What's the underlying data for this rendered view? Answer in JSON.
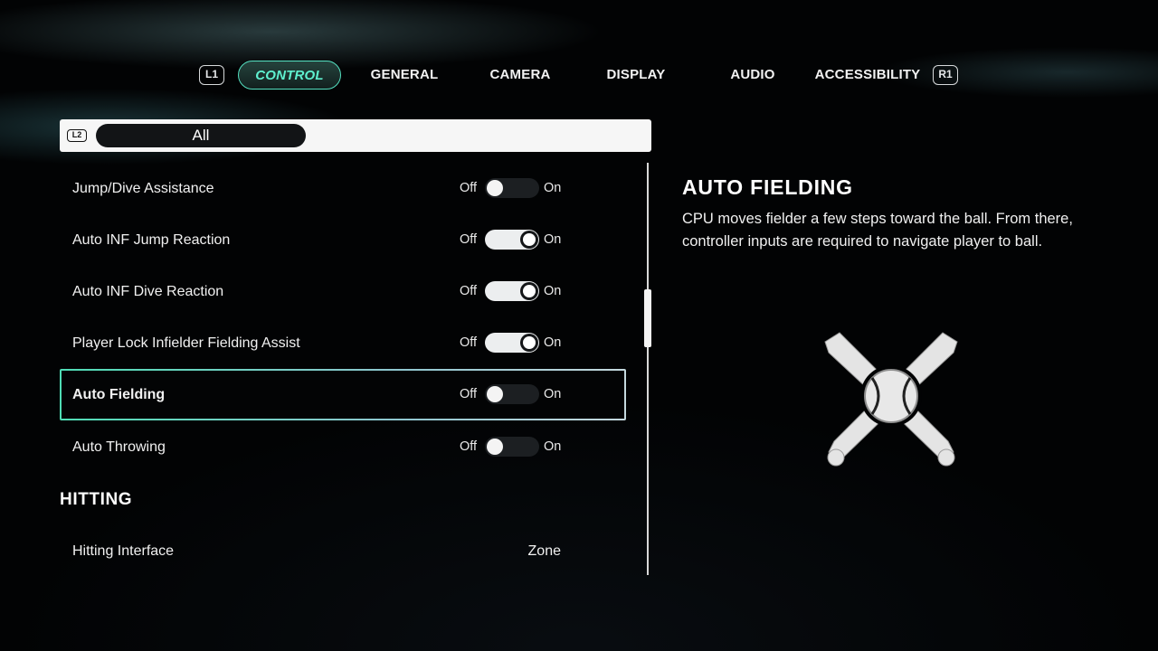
{
  "tabs": {
    "left_shoulder": "L1",
    "right_shoulder": "R1",
    "items": [
      {
        "label": "CONTROL",
        "active": true
      },
      {
        "label": "GENERAL",
        "active": false
      },
      {
        "label": "CAMERA",
        "active": false
      },
      {
        "label": "DISPLAY",
        "active": false
      },
      {
        "label": "AUDIO",
        "active": false
      },
      {
        "label": "ACCESSIBILITY",
        "active": false
      }
    ]
  },
  "filter": {
    "button": "L2",
    "value": "All"
  },
  "settings": [
    {
      "label": "Jump/Dive Assistance",
      "off_label": "Off",
      "on_label": "On",
      "state": "off"
    },
    {
      "label": "Auto INF Jump Reaction",
      "off_label": "Off",
      "on_label": "On",
      "state": "on"
    },
    {
      "label": "Auto INF Dive Reaction",
      "off_label": "Off",
      "on_label": "On",
      "state": "on"
    },
    {
      "label": "Player Lock Infielder Fielding Assist",
      "off_label": "Off",
      "on_label": "On",
      "state": "on"
    },
    {
      "label": "Auto Fielding",
      "off_label": "Off",
      "on_label": "On",
      "state": "off",
      "selected": true
    },
    {
      "label": "Auto Throwing",
      "off_label": "Off",
      "on_label": "On",
      "state": "off"
    }
  ],
  "hitting": {
    "header": "HITTING",
    "items": [
      {
        "label": "Hitting Interface",
        "value": "Zone"
      }
    ]
  },
  "info": {
    "title": "AUTO FIELDING",
    "description": "CPU moves fielder a few steps toward the ball. From there, controller inputs are required to navigate player to ball.",
    "icon": "crossed-bats-ball-icon"
  },
  "colors": {
    "accent": "#5ff0cf",
    "background": "#020304"
  }
}
